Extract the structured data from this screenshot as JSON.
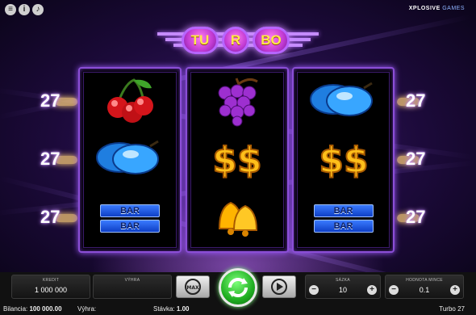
{
  "brand": {
    "main": "XPLOSIVE",
    "suffix": "GAMES"
  },
  "title": {
    "letters": [
      "TU",
      "R",
      "BO"
    ]
  },
  "paylines": {
    "value": "27"
  },
  "reels": [
    {
      "symbols": [
        "cherries",
        "plums",
        "bar"
      ]
    },
    {
      "symbols": [
        "grapes",
        "dollar",
        "bells"
      ]
    },
    {
      "symbols": [
        "plums",
        "dollar",
        "bar"
      ]
    }
  ],
  "bar_label": "BAR",
  "panel": {
    "kredit_label": "KREDIT",
    "kredit_value": "1 000 000",
    "vyhra_label": "VÝHRA",
    "vyhra_value": "",
    "max_label": "MAX",
    "stavka_label": "SÁZKA",
    "stavka_value": "10",
    "coin_label": "HODNOTA MINCE",
    "coin_value": "0.1"
  },
  "status": {
    "bilancia_label": "Bilancia:",
    "bilancia_value": "100 000.00",
    "vyhra_label": "Výhra:",
    "vyhra_value": "",
    "stavka_label": "Stávka:",
    "stavka_value": "1.00",
    "game_name": "Turbo 27"
  },
  "colors": {
    "accent": "#b765ff",
    "spin": "#1fae21",
    "title_text": "#ffe94a"
  }
}
